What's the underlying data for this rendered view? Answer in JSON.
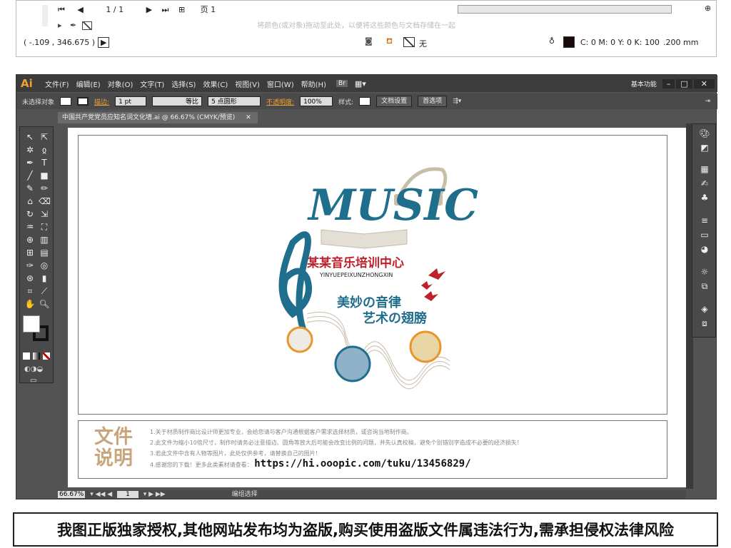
{
  "top_panel": {
    "page_counter": "1 / 1",
    "page_label": "页 1",
    "hint_text": "将颜色(或对象)拖动至此处，以便将这些颜色与文档存储在一起",
    "coords": "( -.109 , 346.675 )",
    "none_label": "无",
    "cmyk_readout": "C: 0 M: 0 Y: 0 K: 100",
    "stroke_width": ".200 mm"
  },
  "menubar": {
    "logo": "Ai",
    "items": [
      "文件(F)",
      "编辑(E)",
      "对象(O)",
      "文字(T)",
      "选择(S)",
      "效果(C)",
      "视图(V)",
      "窗口(W)",
      "帮助(H)"
    ],
    "workspace": "基本功能"
  },
  "controlbar": {
    "no_selection": "未选择对象",
    "stroke_label": "描边:",
    "stroke_value": "1 pt",
    "stroke_style": "等比",
    "brush": "5 点圆形",
    "opacity_label": "不透明度:",
    "opacity_value": "100%",
    "style_label": "样式:",
    "doc_setup": "文档设置",
    "prefs": "首选项"
  },
  "document_tab": {
    "title": "中国共产党党员应知名词文化墙.ai @ 66.67% (CMYK/预览)"
  },
  "artwork": {
    "music_title": "MUSIC",
    "school_name": "某某音乐培训中心",
    "pinyin": "YINYUEPEIXUNZHONGXIN",
    "slogan_line1": "美妙の音律",
    "slogan_line2": "艺术の翅膀"
  },
  "doc_notes": {
    "heading": "文件说明",
    "lines": [
      "1.关于材质制作商比设计师更加专业，会给您请与客户沟通根据客户需求选择材质，或咨询当地制作商。",
      "2.此文件为缩小10倍尺寸，制作时请务必注意描边、圆角等放大后可能会改变比例的问题，并先认真校稿，避免个别错别字造成不必要的经济损失！",
      "3.若此文件中含有人物等图片，此处仅供参考，请替换自己的图片！",
      "4.感谢您的下载！更多此类素材请查看："
    ],
    "url": "https://hi.ooopic.com/tuku/13456829/"
  },
  "statusbar": {
    "zoom": "66.67%",
    "page": "1",
    "mode": "编组选择"
  },
  "footer_text": "我图正版独家授权,其他网站发布均为盗版,购买使用盗版文件属违法行为,需承担侵权法律风险",
  "colors": {
    "music_blue": "#1f6e8c",
    "accent_red": "#c0202a",
    "accent_orange": "#e8962c",
    "gold_text": "#c9a57c"
  }
}
